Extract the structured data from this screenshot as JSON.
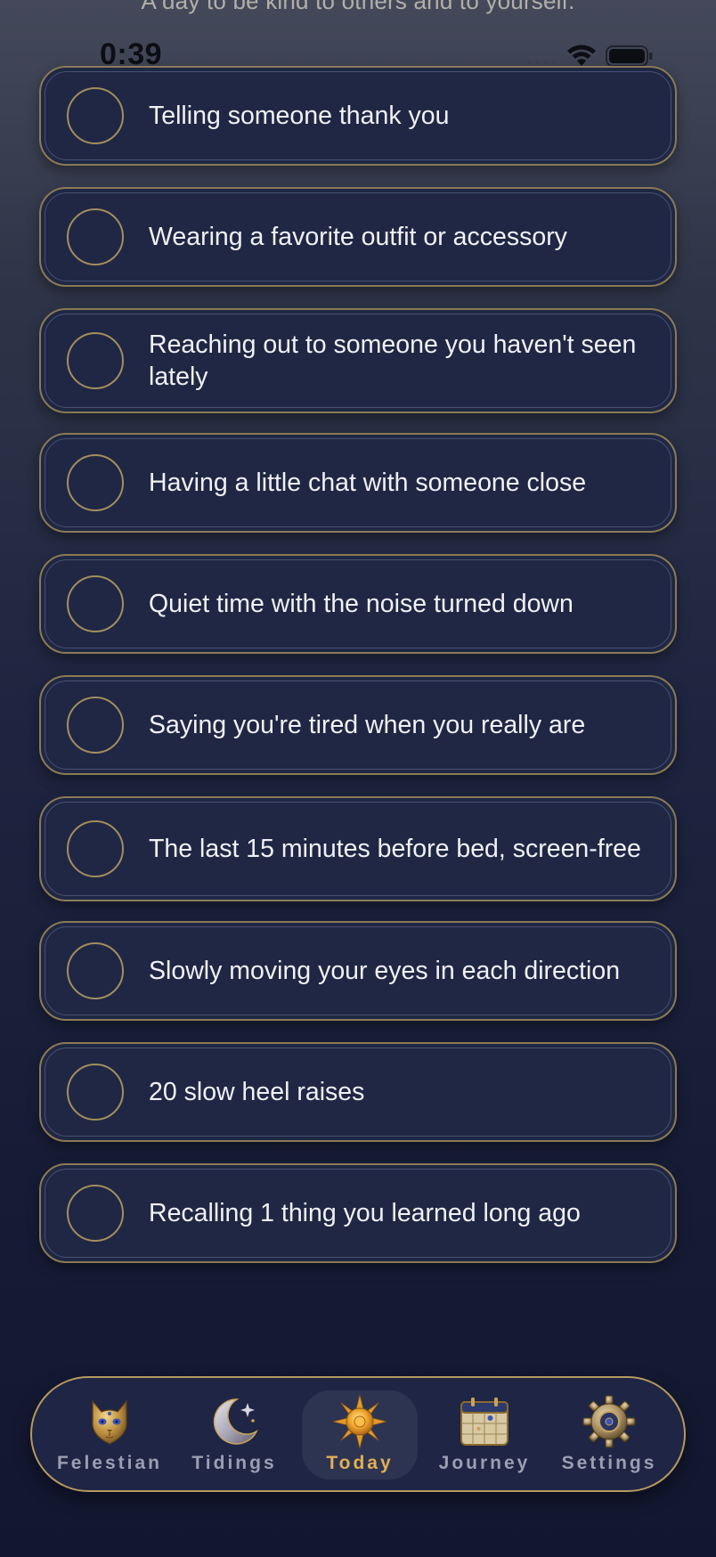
{
  "header": {
    "subtitle": "A day to be kind to others and to yourself."
  },
  "status_bar": {
    "time": "0:39",
    "icons": [
      "signal-icon",
      "wifi-icon",
      "battery-icon"
    ]
  },
  "tasks": [
    {
      "label": "Telling someone thank you",
      "checked": false
    },
    {
      "label": "Wearing a favorite outfit or accessory",
      "checked": false
    },
    {
      "label": "Reaching out to someone you haven't seen lately",
      "checked": false
    },
    {
      "label": "Having a little chat with someone close",
      "checked": false
    },
    {
      "label": "Quiet time with the noise turned down",
      "checked": false
    },
    {
      "label": "Saying you're tired when you really are",
      "checked": false
    },
    {
      "label": "The last 15 minutes before bed, screen-free",
      "checked": false
    },
    {
      "label": "Slowly moving your eyes in each direction",
      "checked": false
    },
    {
      "label": "20 slow heel raises",
      "checked": false
    },
    {
      "label": "Recalling 1 thing you learned long ago",
      "checked": false
    }
  ],
  "tabbar": {
    "active": "Today",
    "tabs": [
      {
        "label": "Felestian",
        "icon": "cat-icon"
      },
      {
        "label": "Tidings",
        "icon": "moon-icon"
      },
      {
        "label": "Today",
        "icon": "sun-icon"
      },
      {
        "label": "Journey",
        "icon": "calendar-icon"
      },
      {
        "label": "Settings",
        "icon": "gear-icon"
      }
    ]
  },
  "colors": {
    "background_top": "#44495a",
    "background_bottom": "#121730",
    "card": "#1f2744",
    "card_border": "#8a7a55",
    "checkbox_ring": "#a38e5e",
    "tab_active_label": "#e0b054",
    "tab_inactive_label": "#9b9fb3"
  }
}
